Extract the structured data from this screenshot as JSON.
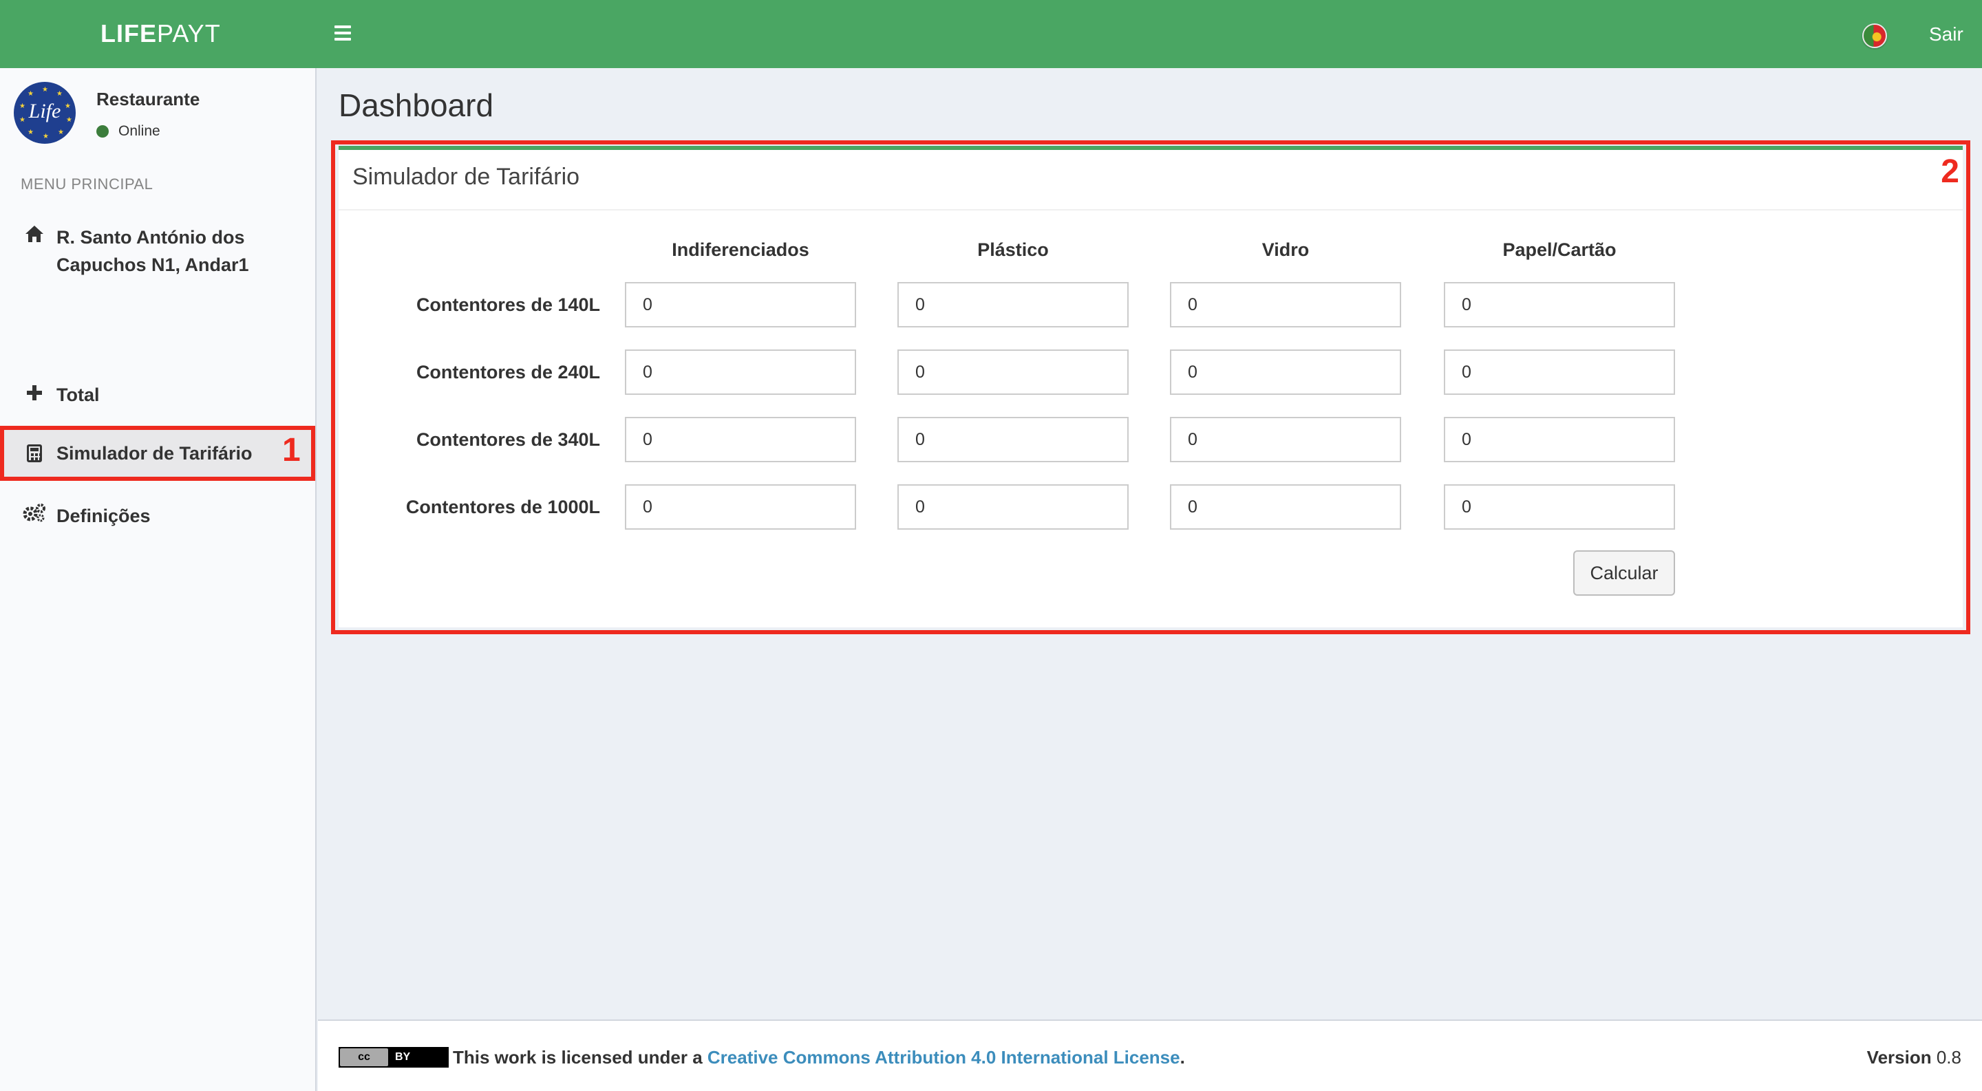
{
  "header": {
    "logo_bold": "LIFE",
    "logo_light": "PAYT",
    "logout_label": "Sair"
  },
  "sidebar": {
    "avatar_text": "Life",
    "user_name": "Restaurante",
    "status": "Online",
    "menu_header": "MENU PRINCIPAL",
    "items": [
      {
        "label": "R. Santo António dos Capuchos N1, Andar1",
        "icon": "home-icon"
      },
      {
        "label": "Total",
        "icon": "plus-icon"
      },
      {
        "label": "Simulador de Tarifário",
        "icon": "calculator-icon",
        "active": true
      },
      {
        "label": "Definições",
        "icon": "gears-icon"
      }
    ]
  },
  "annotations": {
    "one": "1",
    "two": "2"
  },
  "main": {
    "page_title": "Dashboard",
    "box_title": "Simulador de Tarifário",
    "columns": [
      "Indiferenciados",
      "Plástico",
      "Vidro",
      "Papel/Cartão"
    ],
    "rows": [
      {
        "label": "Contentores de 140L",
        "values": [
          "0",
          "0",
          "0",
          "0"
        ]
      },
      {
        "label": "Contentores de 240L",
        "values": [
          "0",
          "0",
          "0",
          "0"
        ]
      },
      {
        "label": "Contentores de 340L",
        "values": [
          "0",
          "0",
          "0",
          "0"
        ]
      },
      {
        "label": "Contentores de 1000L",
        "values": [
          "0",
          "0",
          "0",
          "0"
        ]
      }
    ],
    "calculate_label": "Calcular"
  },
  "footer": {
    "cc_label": "cc",
    "by_label": "BY",
    "license_prefix": "This work is licensed under a ",
    "license_link": "Creative Commons Attribution 4.0 International License",
    "license_suffix": ".",
    "version_label": "Version",
    "version_number": "0.8"
  },
  "colors": {
    "header_green": "#4aa663",
    "annotation_red": "#ee2a1f",
    "link_blue": "#3c8dbc"
  }
}
